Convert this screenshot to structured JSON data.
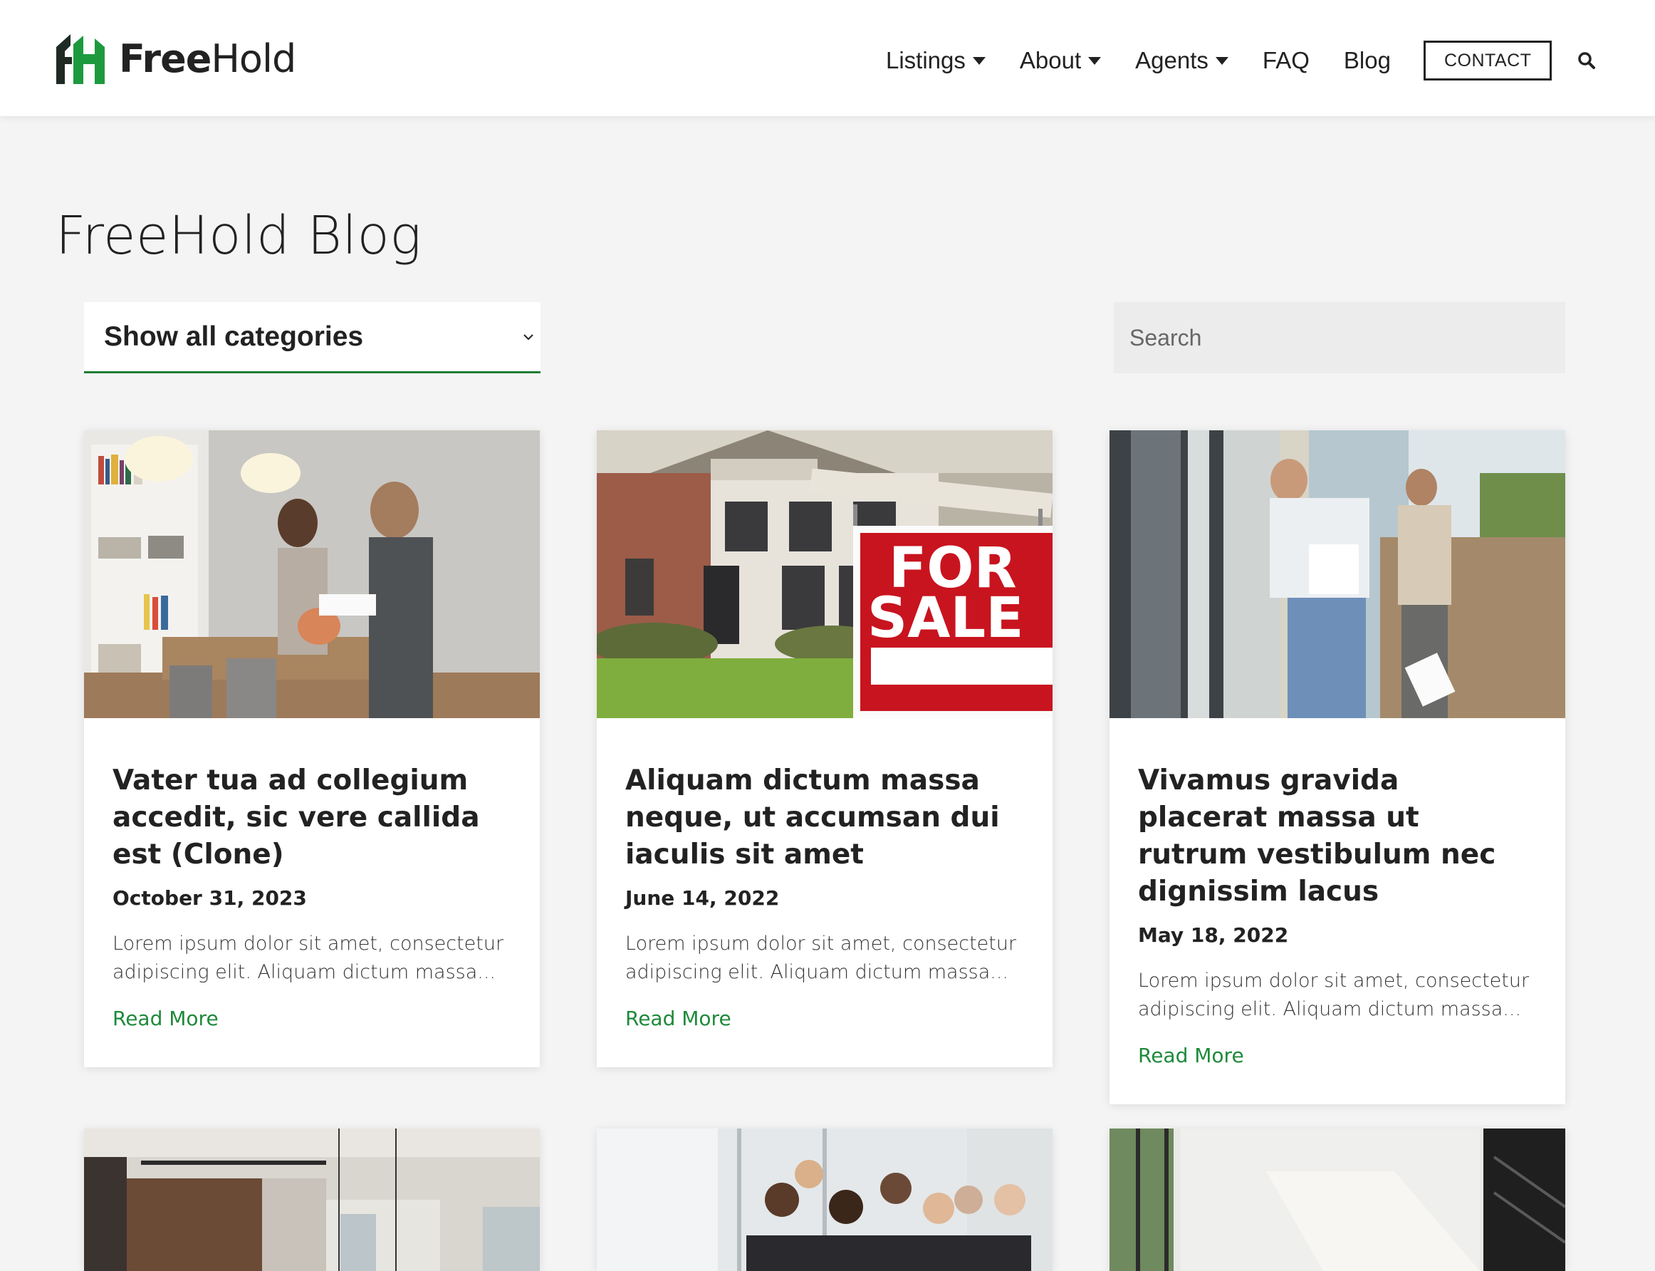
{
  "brand": {
    "name_part1": "Free",
    "name_part2": "Hold",
    "accent": "#1e8a3a"
  },
  "nav": {
    "items": [
      {
        "label": "Listings",
        "has_dropdown": true
      },
      {
        "label": "About",
        "has_dropdown": true
      },
      {
        "label": "Agents",
        "has_dropdown": true
      },
      {
        "label": "FAQ",
        "has_dropdown": false
      },
      {
        "label": "Blog",
        "has_dropdown": false
      }
    ],
    "contact_label": "CONTACT",
    "search_icon": "search-icon"
  },
  "page": {
    "title": "FreeHold Blog"
  },
  "filters": {
    "category_selected": "Show all categories",
    "search_placeholder": "Search"
  },
  "posts": [
    {
      "title": "Vater tua ad collegium accedit, sic vere callida est (Clone)",
      "date": "October 31, 2023",
      "excerpt": "Lorem ipsum dolor sit amet, consectetur adipiscing elit. Aliquam dictum massa...",
      "link_label": "Read More",
      "image": "agent-with-client-photo"
    },
    {
      "title": "Aliquam dictum massa neque, ut accumsan dui iaculis sit amet",
      "date": "June 14, 2022",
      "excerpt": "Lorem ipsum dolor sit amet, consectetur adipiscing elit. Aliquam dictum massa...",
      "link_label": "Read More",
      "image": "for-sale-sign-photo",
      "sign_line1": "FOR",
      "sign_line2": "SALE"
    },
    {
      "title": "Vivamus gravida placerat massa ut rutrum vestibulum nec dignissim lacus",
      "date": "May 18, 2022",
      "excerpt": "Lorem ipsum dolor sit amet, consectetur adipiscing elit. Aliquam dictum massa...",
      "link_label": "Read More",
      "image": "home-inspection-photo"
    }
  ],
  "posts_row2": [
    {
      "image": "modern-dining-room-photo"
    },
    {
      "image": "team-group-photo"
    },
    {
      "image": "bright-interior-photo"
    }
  ]
}
